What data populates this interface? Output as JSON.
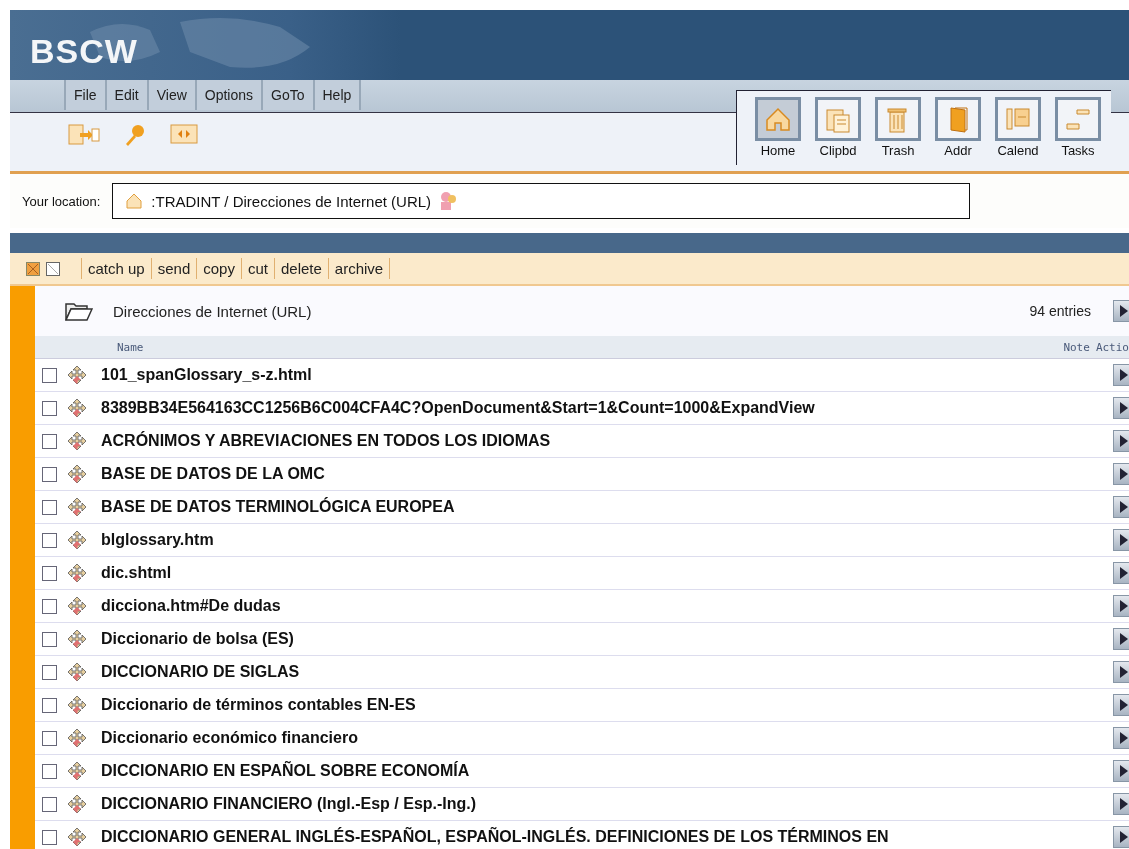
{
  "banner": {
    "logo": "BSCW"
  },
  "menu": [
    {
      "label": "File"
    },
    {
      "label": "Edit"
    },
    {
      "label": "View"
    },
    {
      "label": "Options"
    },
    {
      "label": "GoTo"
    },
    {
      "label": "Help"
    }
  ],
  "tools": [
    {
      "kind": "home",
      "label": "Home",
      "selected": true
    },
    {
      "kind": "clipboard",
      "label": "Clipbd",
      "selected": false
    },
    {
      "kind": "trash",
      "label": "Trash",
      "selected": false
    },
    {
      "kind": "addr",
      "label": "Addr",
      "selected": false
    },
    {
      "kind": "calendar",
      "label": "Calend",
      "selected": false
    },
    {
      "kind": "tasks",
      "label": "Tasks",
      "selected": false
    }
  ],
  "location": {
    "label": "Your location:",
    "path": ":TRADINT / Direcciones de Internet (URL)"
  },
  "actions": [
    "catch up",
    "send",
    "copy",
    "cut",
    "delete",
    "archive"
  ],
  "folder": {
    "name": "Direcciones de Internet (URL)",
    "count": "94 entries"
  },
  "columns": [
    "Name",
    "Note",
    "Actio"
  ],
  "rows": [
    {
      "name": "101_spanGlossary_s-z.html",
      "checked": false
    },
    {
      "name": "8389BB34E564163CC1256B6C004CFA4C?OpenDocument&Start=1&Count=1000&ExpandView",
      "checked": false
    },
    {
      "name": "ACRÓNIMOS Y ABREVIACIONES EN TODOS LOS IDIOMAS",
      "checked": false
    },
    {
      "name": "BASE DE DATOS DE LA OMC",
      "checked": false
    },
    {
      "name": "BASE DE DATOS TERMINOLÓGICA EUROPEA",
      "checked": false
    },
    {
      "name": "blglossary.htm",
      "checked": false
    },
    {
      "name": "dic.shtml",
      "checked": false
    },
    {
      "name": "dicciona.htm#De dudas",
      "checked": false
    },
    {
      "name": "Diccionario de bolsa (ES)",
      "checked": false
    },
    {
      "name": "DICCIONARIO DE SIGLAS",
      "checked": false
    },
    {
      "name": "Diccionario de términos contables EN-ES",
      "checked": false
    },
    {
      "name": "Diccionario económico financiero",
      "checked": false
    },
    {
      "name": "DICCIONARIO EN ESPAÑOL SOBRE ECONOMÍA",
      "checked": false
    },
    {
      "name": "DICCIONARIO FINANCIERO (Ingl.-Esp / Esp.-Ing.)",
      "checked": false
    },
    {
      "name": "DICCIONARIO GENERAL INGLÉS-ESPAÑOL, ESPAÑOL-INGLÉS. DEFINICIONES DE LOS TÉRMINOS EN",
      "checked": false
    }
  ]
}
